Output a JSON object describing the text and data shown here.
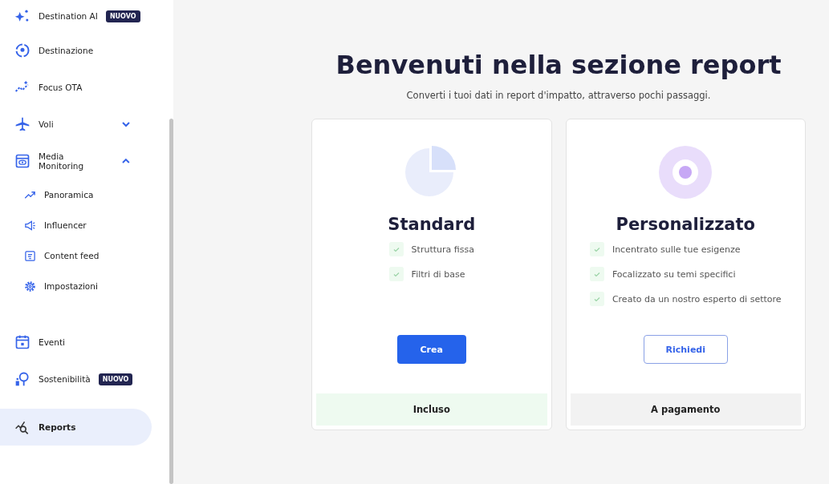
{
  "sidebar": {
    "items": [
      {
        "label": "Destination AI",
        "badge": "NUOVO",
        "selected": false
      },
      {
        "label": "Destinazione",
        "selected": false
      },
      {
        "label": "Focus OTA",
        "selected": false
      },
      {
        "label": "Voli",
        "expanded": false,
        "selected": false
      },
      {
        "label": "Media Monitoring",
        "expanded": true,
        "selected": false,
        "children": [
          {
            "label": "Panoramica",
            "selected": false
          },
          {
            "label": "Influencer",
            "selected": false
          },
          {
            "label": "Content feed",
            "selected": false
          },
          {
            "label": "Impostazioni",
            "selected": false
          }
        ]
      },
      {
        "label": "Eventi",
        "selected": false
      },
      {
        "label": "Sostenibilità",
        "badge": "NUOVO",
        "selected": false
      },
      {
        "label": "Reports",
        "selected": true
      }
    ]
  },
  "main": {
    "title": "Benvenuti nella sezione report",
    "subtitle": "Converti i tuoi dati in report d'impatto, attraverso pochi passaggi.",
    "cards": [
      {
        "kind": "standard",
        "title": "Standard",
        "features": [
          "Struttura fissa",
          "Filtri di base"
        ],
        "button": "Crea",
        "footer": "Incluso"
      },
      {
        "kind": "custom",
        "title": "Personalizzato",
        "features": [
          "Incentrato sulle tue esigenze",
          "Focalizzato su temi specifici",
          "Creato da un nostro esperto di settore"
        ],
        "button": "Richiedi",
        "footer": "A pagamento"
      }
    ]
  }
}
